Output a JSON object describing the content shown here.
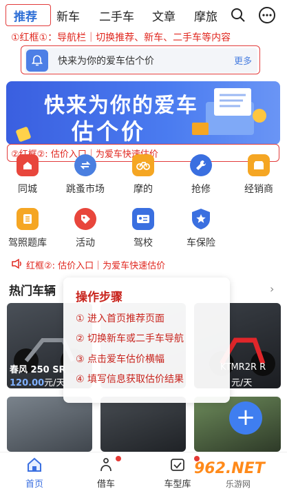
{
  "nav": {
    "tabs": [
      "推荐",
      "新车",
      "二手车",
      "文章",
      "摩旅"
    ],
    "annotation": "①红框①：导航栏｜切换推荐、新车、二手车等内容"
  },
  "notice": {
    "text": "快来为你的爱车估个价",
    "more": "更多"
  },
  "banner": {
    "line1": "快来为你的爱车",
    "line2": "估个价"
  },
  "annotation2": "②红框②: 估价入口｜为爱车快速估价",
  "grid": [
    {
      "label": "同城",
      "icon": "home-icon",
      "color": "#e8463c"
    },
    {
      "label": "跳蚤市场",
      "icon": "swap-icon",
      "color": "#4a7fe0"
    },
    {
      "label": "摩的",
      "icon": "bicycle-icon",
      "color": "#f5a623"
    },
    {
      "label": "抢修",
      "icon": "wrench-icon",
      "color": "#3a6fe0"
    },
    {
      "label": "经销商",
      "icon": "store-icon",
      "color": "#f5a623"
    },
    {
      "label": "驾照题库",
      "icon": "list-icon",
      "color": "#f5a623"
    },
    {
      "label": "活动",
      "icon": "tag-icon",
      "color": "#e8463c"
    },
    {
      "label": "驾校",
      "icon": "id-card-icon",
      "color": "#3a6fe0"
    },
    {
      "label": "车保险",
      "icon": "shield-star-icon",
      "color": "#3a6fe0"
    }
  ],
  "annotation3": "红框②: 估价入口｜为爱车快速估价",
  "hot": {
    "title": "热门车辆",
    "cards": [
      {
        "name": "春风 250 SR",
        "price": "120.00",
        "unit": "元/天"
      },
      {
        "name": "",
        "price": "",
        "unit": ""
      },
      {
        "name": "KTMR2R R",
        "price": "",
        "unit": "元/天"
      }
    ]
  },
  "steps": {
    "title": "操作步骤",
    "items": [
      "① 进入首页推荐页面",
      "② 切换新车或二手车导航",
      "③ 点击爱车估价横幅",
      "④ 填写信息获取估价结果"
    ]
  },
  "bottom": {
    "items": [
      "首页",
      "借车",
      "车型库"
    ]
  },
  "watermark": {
    "brand": "962.NET",
    "sub": "乐游网"
  }
}
